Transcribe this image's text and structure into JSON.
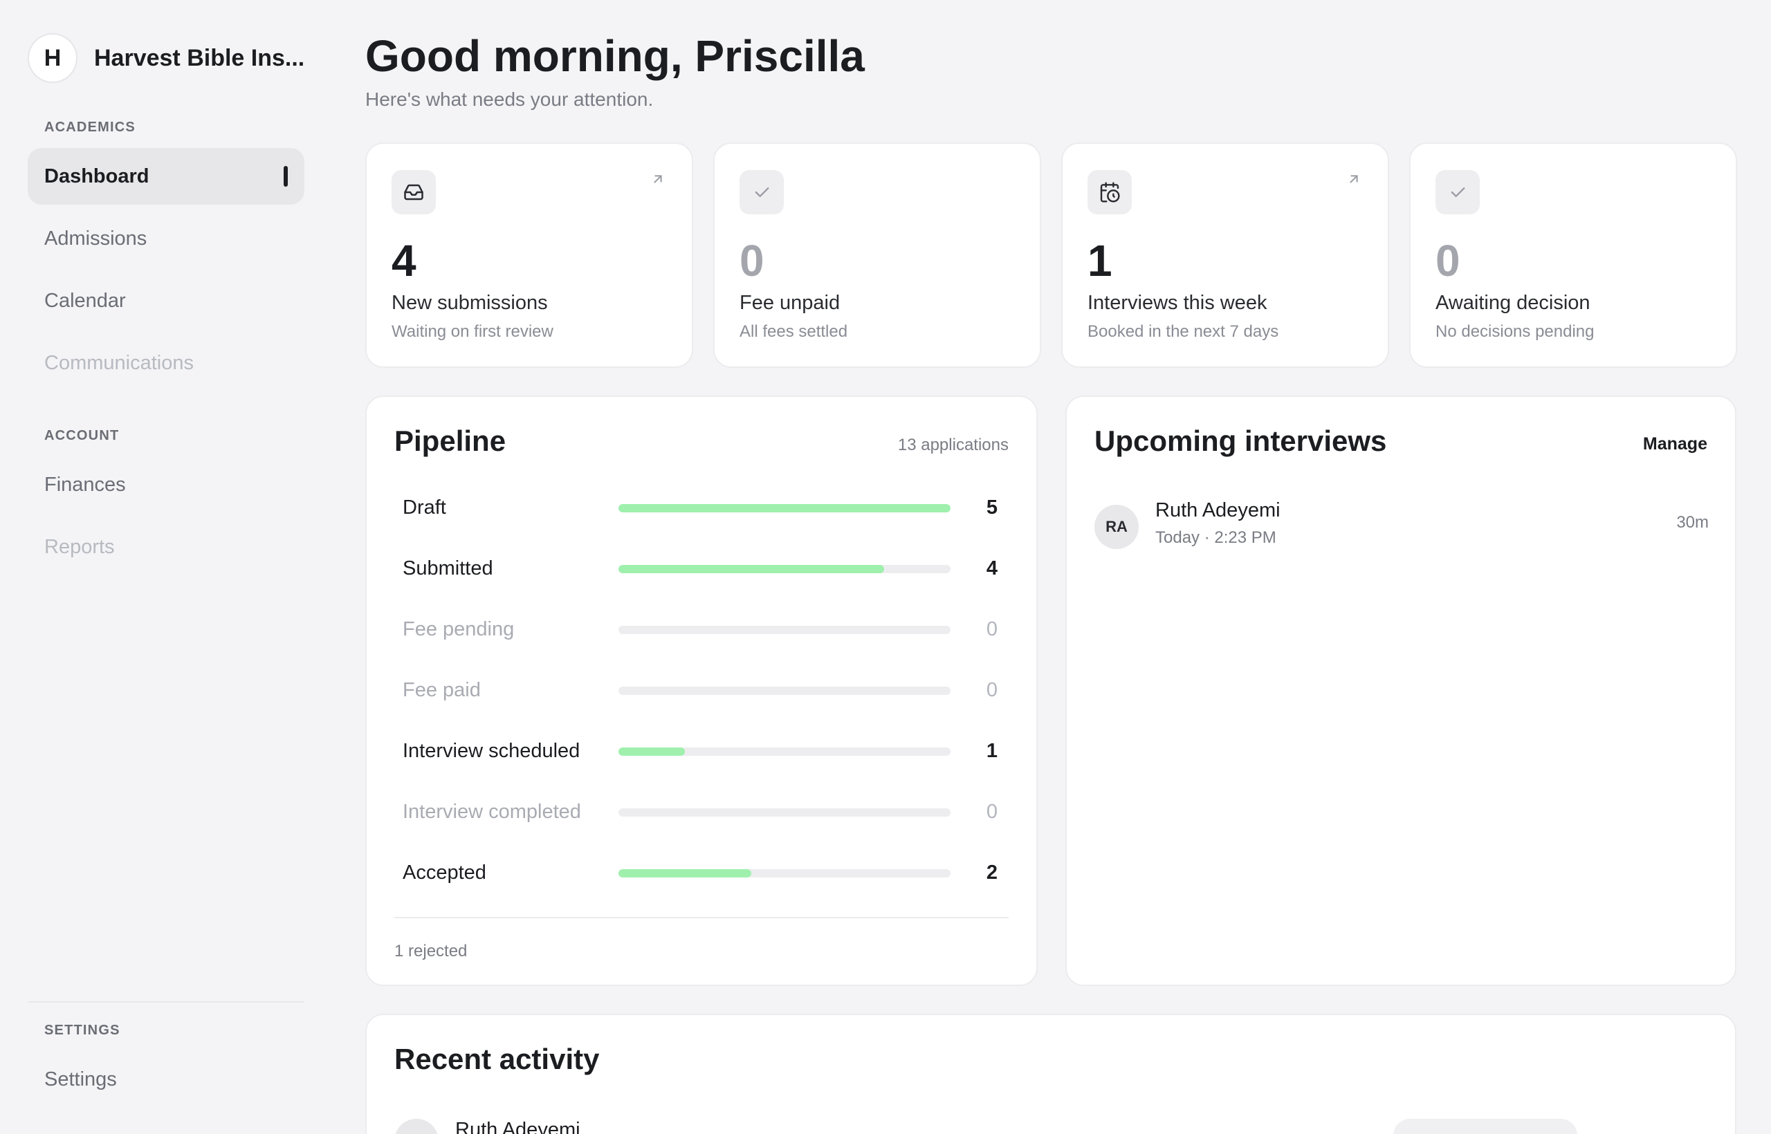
{
  "brand": {
    "initial": "H",
    "name": "Harvest Bible Ins..."
  },
  "sidebar": {
    "sections": [
      {
        "heading": "ACADEMICS",
        "items": [
          {
            "label": "Dashboard",
            "state": "active"
          },
          {
            "label": "Admissions",
            "state": "normal"
          },
          {
            "label": "Calendar",
            "state": "normal"
          },
          {
            "label": "Communications",
            "state": "disabled"
          }
        ]
      },
      {
        "heading": "ACCOUNT",
        "items": [
          {
            "label": "Finances",
            "state": "normal"
          },
          {
            "label": "Reports",
            "state": "disabled"
          }
        ]
      },
      {
        "heading": "SETTINGS",
        "items": [
          {
            "label": "Settings",
            "state": "normal"
          }
        ]
      }
    ]
  },
  "header": {
    "greeting": "Good morning, Priscilla",
    "subtitle": "Here's what needs your attention."
  },
  "stats": [
    {
      "icon": "inbox-icon",
      "arrow": true,
      "value": "4",
      "label": "New submissions",
      "desc": "Waiting on first review",
      "muted": false
    },
    {
      "icon": "check-icon",
      "arrow": false,
      "value": "0",
      "label": "Fee unpaid",
      "desc": "All fees settled",
      "muted": true
    },
    {
      "icon": "calendar-clock-icon",
      "arrow": true,
      "value": "1",
      "label": "Interviews this week",
      "desc": "Booked in the next 7 days",
      "muted": false
    },
    {
      "icon": "check-icon",
      "arrow": false,
      "value": "0",
      "label": "Awaiting decision",
      "desc": "No decisions pending",
      "muted": true
    }
  ],
  "pipeline": {
    "title": "Pipeline",
    "meta": "13 applications",
    "max": 5,
    "rows": [
      {
        "label": "Draft",
        "count": 5
      },
      {
        "label": "Submitted",
        "count": 4
      },
      {
        "label": "Fee pending",
        "count": 0
      },
      {
        "label": "Fee paid",
        "count": 0
      },
      {
        "label": "Interview scheduled",
        "count": 1
      },
      {
        "label": "Interview completed",
        "count": 0
      },
      {
        "label": "Accepted",
        "count": 2
      }
    ],
    "footer": "1 rejected"
  },
  "interviews": {
    "title": "Upcoming interviews",
    "action": "Manage",
    "items": [
      {
        "initials": "RA",
        "name": "Ruth Adeyemi",
        "time": "Today · 2:23 PM",
        "duration": "30m"
      }
    ]
  },
  "activity": {
    "title": "Recent activity",
    "items": [
      {
        "name": "Ruth Adeyemi"
      }
    ]
  },
  "colors": {
    "accent_bar": "#9ff0ad",
    "track": "#ededf0",
    "background": "#f4f4f6"
  }
}
